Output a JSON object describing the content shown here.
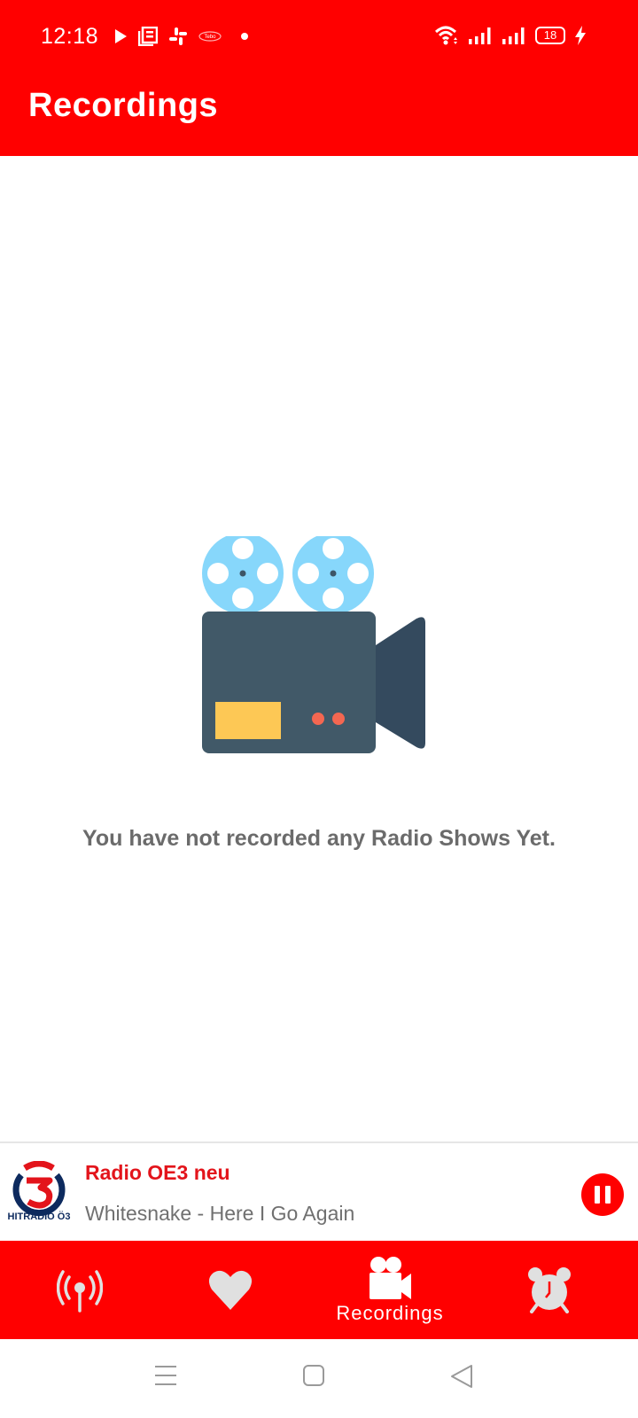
{
  "status_bar": {
    "time": "12:18",
    "notification_icons": [
      "play-icon",
      "news-icon",
      "slack-icon",
      "app-logo-icon",
      "dot-icon"
    ],
    "battery_level": "18",
    "right_icons": [
      "wifi-icon",
      "signal-icon",
      "signal-icon",
      "battery-icon",
      "charging-icon"
    ]
  },
  "app_bar": {
    "title": "Recordings"
  },
  "empty_state": {
    "illustration": "video-camera-illustration",
    "message": "You have not recorded any Radio Shows Yet."
  },
  "player": {
    "station_logo_text": "HITRADIO Ö3",
    "station_name": "Radio OE3 neu",
    "track": "Whitesnake - Here I Go Again",
    "state": "playing",
    "control": "pause"
  },
  "bottom_nav": {
    "items": [
      {
        "icon": "radio-tower-icon",
        "label": "",
        "active": false
      },
      {
        "icon": "heart-icon",
        "label": "",
        "active": false
      },
      {
        "icon": "video-camera-icon",
        "label": "Recordings",
        "active": true
      },
      {
        "icon": "alarm-clock-icon",
        "label": "",
        "active": false
      }
    ]
  },
  "colors": {
    "primary": "#ff0000",
    "station_name": "#e3141b",
    "text_muted": "#6b6b6b"
  }
}
